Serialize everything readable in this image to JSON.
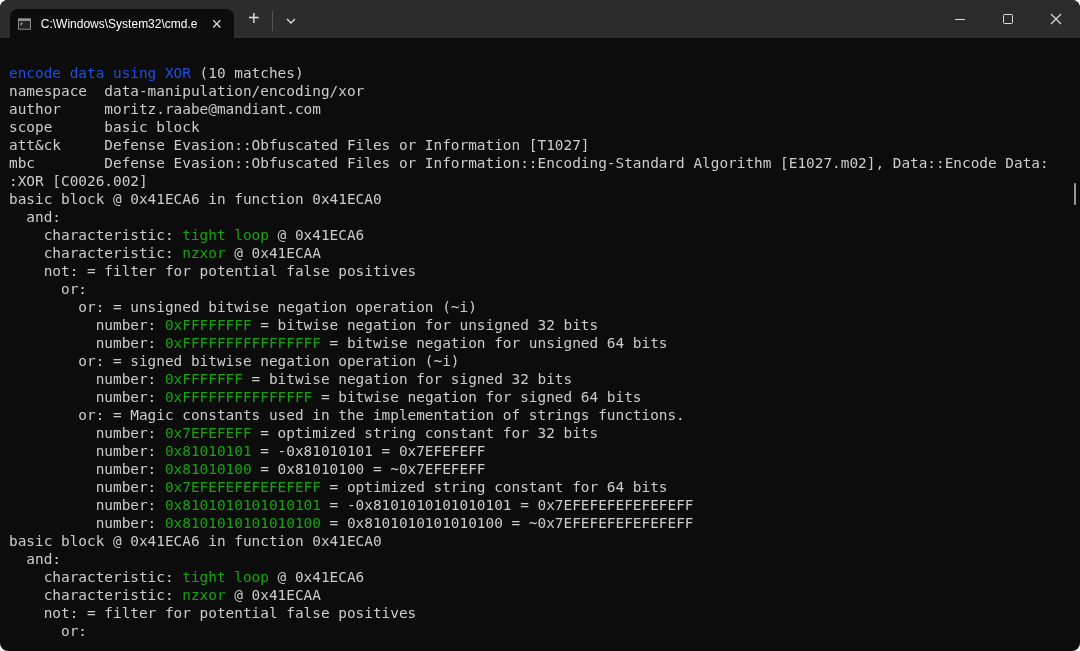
{
  "window": {
    "tab_title": "C:\\Windows\\System32\\cmd.e",
    "tab_close": "×",
    "new_tab": "+"
  },
  "terminal": {
    "lines": [
      {
        "parts": [
          {
            "text": "encode data using XOR",
            "color": "#1f4fe0"
          },
          {
            "text": " (10 matches)",
            "color": "#cccccc"
          }
        ]
      },
      {
        "parts": [
          {
            "text": "namespace  data-manipulation/encoding/xor",
            "color": "#cccccc"
          }
        ]
      },
      {
        "parts": [
          {
            "text": "author     moritz.raabe@mandiant.com",
            "color": "#cccccc"
          }
        ]
      },
      {
        "parts": [
          {
            "text": "scope      basic block",
            "color": "#cccccc"
          }
        ]
      },
      {
        "parts": [
          {
            "text": "att&ck     Defense Evasion::Obfuscated Files or Information [T1027]",
            "color": "#cccccc"
          }
        ]
      },
      {
        "parts": [
          {
            "text": "mbc        Defense Evasion::Obfuscated Files or Information::Encoding-Standard Algorithm [E1027.m02], Data::Encode Data:",
            "color": "#cccccc"
          }
        ]
      },
      {
        "parts": [
          {
            "text": ":XOR [C0026.002]",
            "color": "#cccccc"
          }
        ]
      },
      {
        "parts": [
          {
            "text": "basic block @ 0x41ECA6 in function 0x41ECA0",
            "color": "#cccccc"
          }
        ]
      },
      {
        "parts": [
          {
            "text": "  and:",
            "color": "#cccccc"
          }
        ]
      },
      {
        "parts": [
          {
            "text": "    characteristic: ",
            "color": "#cccccc"
          },
          {
            "text": "tight loop",
            "color": "#16a30e"
          },
          {
            "text": " @ 0x41ECA6",
            "color": "#cccccc"
          }
        ]
      },
      {
        "parts": [
          {
            "text": "    characteristic: ",
            "color": "#cccccc"
          },
          {
            "text": "nzxor",
            "color": "#16a30e"
          },
          {
            "text": " @ 0x41ECAA",
            "color": "#cccccc"
          }
        ]
      },
      {
        "parts": [
          {
            "text": "    not: = filter for potential false positives",
            "color": "#cccccc"
          }
        ]
      },
      {
        "parts": [
          {
            "text": "      or:",
            "color": "#cccccc"
          }
        ]
      },
      {
        "parts": [
          {
            "text": "        or: = unsigned bitwise negation operation (~i)",
            "color": "#cccccc"
          }
        ]
      },
      {
        "parts": [
          {
            "text": "          number: ",
            "color": "#cccccc"
          },
          {
            "text": "0xFFFFFFFF",
            "color": "#16a30e"
          },
          {
            "text": " = bitwise negation for unsigned 32 bits",
            "color": "#cccccc"
          }
        ]
      },
      {
        "parts": [
          {
            "text": "          number: ",
            "color": "#cccccc"
          },
          {
            "text": "0xFFFFFFFFFFFFFFFF",
            "color": "#16a30e"
          },
          {
            "text": " = bitwise negation for unsigned 64 bits",
            "color": "#cccccc"
          }
        ]
      },
      {
        "parts": [
          {
            "text": "        or: = signed bitwise negation operation (~i)",
            "color": "#cccccc"
          }
        ]
      },
      {
        "parts": [
          {
            "text": "          number: ",
            "color": "#cccccc"
          },
          {
            "text": "0xFFFFFFF",
            "color": "#16a30e"
          },
          {
            "text": " = bitwise negation for signed 32 bits",
            "color": "#cccccc"
          }
        ]
      },
      {
        "parts": [
          {
            "text": "          number: ",
            "color": "#cccccc"
          },
          {
            "text": "0xFFFFFFFFFFFFFFF",
            "color": "#16a30e"
          },
          {
            "text": " = bitwise negation for signed 64 bits",
            "color": "#cccccc"
          }
        ]
      },
      {
        "parts": [
          {
            "text": "        or: = Magic constants used in the implementation of strings functions.",
            "color": "#cccccc"
          }
        ]
      },
      {
        "parts": [
          {
            "text": "          number: ",
            "color": "#cccccc"
          },
          {
            "text": "0x7EFEFEFF",
            "color": "#16a30e"
          },
          {
            "text": " = optimized string constant for 32 bits",
            "color": "#cccccc"
          }
        ]
      },
      {
        "parts": [
          {
            "text": "          number: ",
            "color": "#cccccc"
          },
          {
            "text": "0x81010101",
            "color": "#16a30e"
          },
          {
            "text": " = -0x81010101 = 0x7EFEFEFF",
            "color": "#cccccc"
          }
        ]
      },
      {
        "parts": [
          {
            "text": "          number: ",
            "color": "#cccccc"
          },
          {
            "text": "0x81010100",
            "color": "#16a30e"
          },
          {
            "text": " = 0x81010100 = ~0x7EFEFEFF",
            "color": "#cccccc"
          }
        ]
      },
      {
        "parts": [
          {
            "text": "          number: ",
            "color": "#cccccc"
          },
          {
            "text": "0x7EFEFEFEFEFEFEFF",
            "color": "#16a30e"
          },
          {
            "text": " = optimized string constant for 64 bits",
            "color": "#cccccc"
          }
        ]
      },
      {
        "parts": [
          {
            "text": "          number: ",
            "color": "#cccccc"
          },
          {
            "text": "0x8101010101010101",
            "color": "#16a30e"
          },
          {
            "text": " = -0x8101010101010101 = 0x7EFEFEFEFEFEFEFF",
            "color": "#cccccc"
          }
        ]
      },
      {
        "parts": [
          {
            "text": "          number: ",
            "color": "#cccccc"
          },
          {
            "text": "0x8101010101010100",
            "color": "#16a30e"
          },
          {
            "text": " = 0x8101010101010100 = ~0x7EFEFEFEFEFEFEFF",
            "color": "#cccccc"
          }
        ]
      },
      {
        "parts": [
          {
            "text": "basic block @ 0x41ECA6 in function 0x41ECA0",
            "color": "#cccccc"
          }
        ]
      },
      {
        "parts": [
          {
            "text": "  and:",
            "color": "#cccccc"
          }
        ]
      },
      {
        "parts": [
          {
            "text": "    characteristic: ",
            "color": "#cccccc"
          },
          {
            "text": "tight loop",
            "color": "#16a30e"
          },
          {
            "text": " @ 0x41ECA6",
            "color": "#cccccc"
          }
        ]
      },
      {
        "parts": [
          {
            "text": "    characteristic: ",
            "color": "#cccccc"
          },
          {
            "text": "nzxor",
            "color": "#16a30e"
          },
          {
            "text": " @ 0x41ECAA",
            "color": "#cccccc"
          }
        ]
      },
      {
        "parts": [
          {
            "text": "    not: = filter for potential false positives",
            "color": "#cccccc"
          }
        ]
      },
      {
        "parts": [
          {
            "text": "      or:",
            "color": "#cccccc"
          }
        ]
      }
    ]
  }
}
